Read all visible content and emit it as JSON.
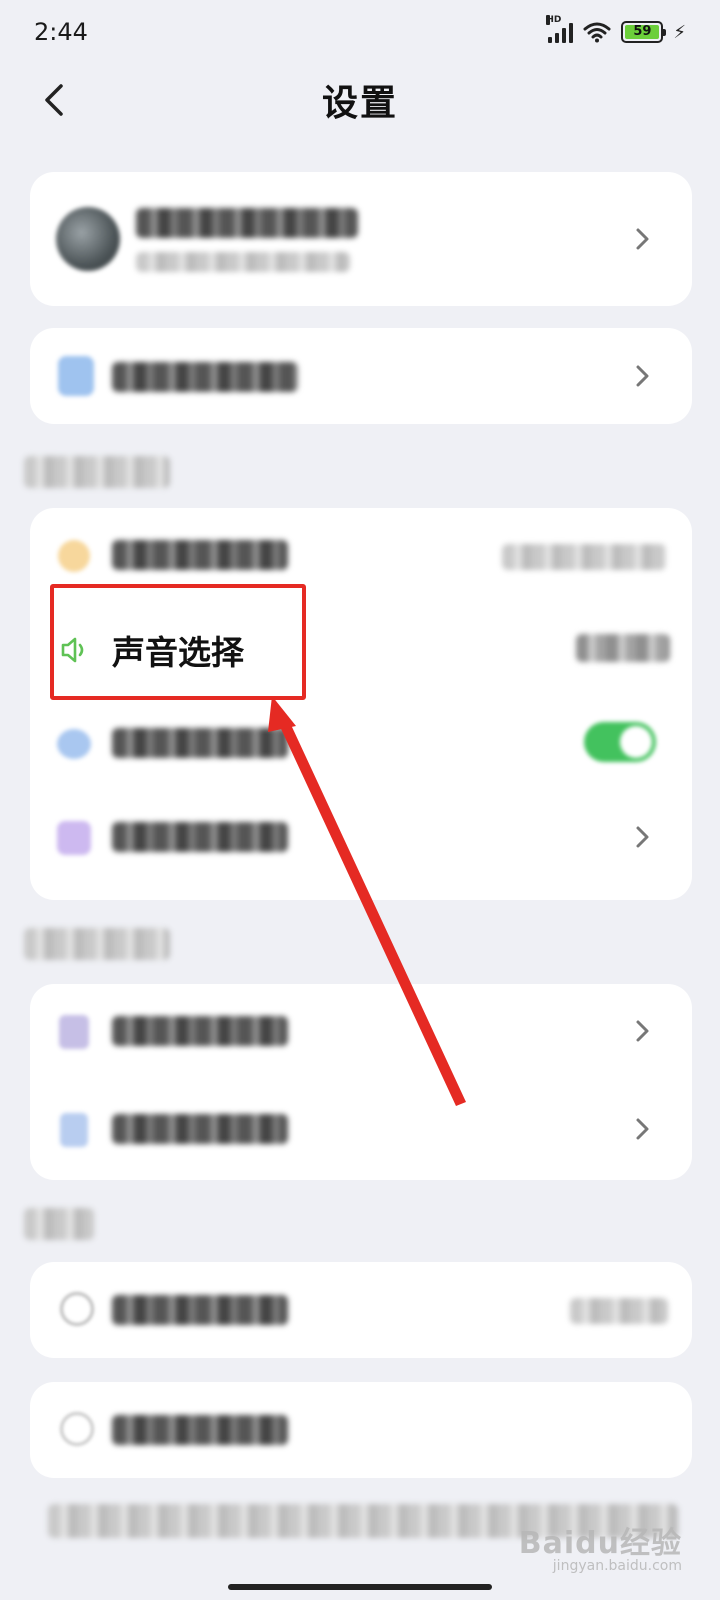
{
  "status_bar": {
    "time": "2:44",
    "network": "HD",
    "battery_level": "59"
  },
  "header": {
    "title": "设置"
  },
  "settings": {
    "sound_selection_label": "声音选择"
  },
  "watermark": {
    "brand": "Baidu经验",
    "site": "jingyan.baidu.com"
  },
  "colors": {
    "background": "#eff0f5",
    "card": "#ffffff",
    "highlight": "#e52a23",
    "toggle_on": "#43c25e",
    "speaker_icon": "#5fc255"
  },
  "icons": {
    "back": "chevron-left-icon",
    "row_chevron": "chevron-right-icon",
    "sound": "speaker-icon",
    "signal": "signal-icon",
    "wifi": "wifi-icon",
    "charging": "bolt-icon"
  }
}
